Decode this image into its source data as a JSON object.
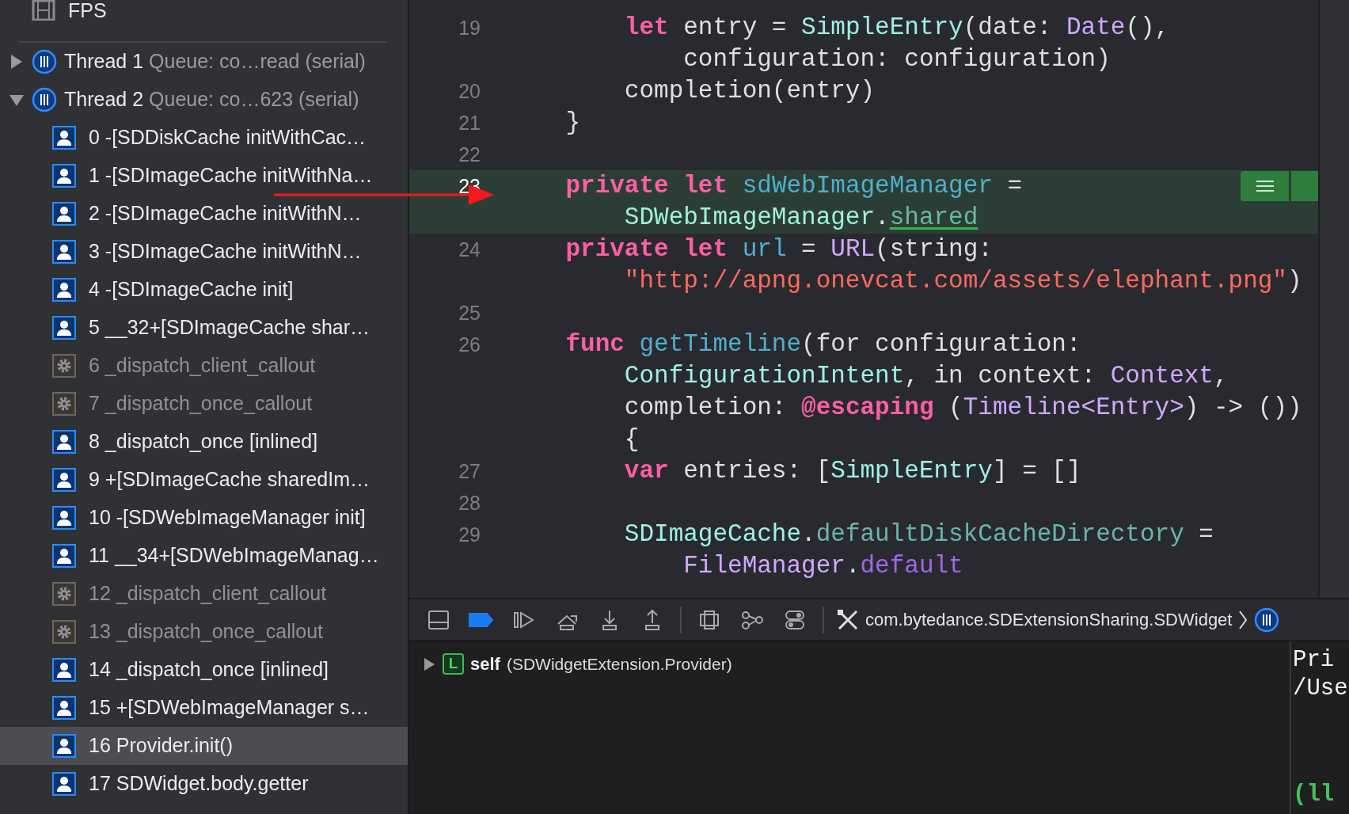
{
  "navigator": {
    "target": "FPS",
    "threads": [
      {
        "name": "Thread 1",
        "queue": "Queue: co…read (serial)",
        "expanded": false
      },
      {
        "name": "Thread 2",
        "queue": "Queue: co…623 (serial)",
        "expanded": true,
        "frames": [
          {
            "label": "0 -[SDDiskCache initWithCac…",
            "kind": "user",
            "selected": false
          },
          {
            "label": "1 -[SDImageCache initWithNa…",
            "kind": "user",
            "selected": false
          },
          {
            "label": "2 -[SDImageCache initWithN…",
            "kind": "user",
            "selected": false
          },
          {
            "label": "3 -[SDImageCache initWithN…",
            "kind": "user",
            "selected": false
          },
          {
            "label": "4 -[SDImageCache init]",
            "kind": "user",
            "selected": false
          },
          {
            "label": "5 __32+[SDImageCache shar…",
            "kind": "user",
            "selected": false
          },
          {
            "label": "6 _dispatch_client_callout",
            "kind": "system",
            "selected": false
          },
          {
            "label": "7 _dispatch_once_callout",
            "kind": "system",
            "selected": false
          },
          {
            "label": "8 _dispatch_once [inlined]",
            "kind": "user",
            "selected": false
          },
          {
            "label": "9 +[SDImageCache sharedIm…",
            "kind": "user",
            "selected": false
          },
          {
            "label": "10 -[SDWebImageManager init]",
            "kind": "user",
            "selected": false
          },
          {
            "label": "11 __34+[SDWebImageManag…",
            "kind": "user",
            "selected": false
          },
          {
            "label": "12 _dispatch_client_callout",
            "kind": "system",
            "selected": false
          },
          {
            "label": "13 _dispatch_once_callout",
            "kind": "system",
            "selected": false
          },
          {
            "label": "14 _dispatch_once [inlined]",
            "kind": "user",
            "selected": false
          },
          {
            "label": "15 +[SDWebImageManager s…",
            "kind": "user",
            "selected": false
          },
          {
            "label": "16 Provider.init()",
            "kind": "user",
            "selected": true
          },
          {
            "label": "17 SDWidget.body.getter",
            "kind": "user",
            "selected": false
          }
        ]
      }
    ]
  },
  "editor": {
    "lines": [
      {
        "number": "19",
        "current": false,
        "rows": [
          {
            "tokens": [
              {
                "text": "        let",
                "kind": "keyword"
              },
              {
                "text": " entry = ",
                "kind": "plain"
              },
              {
                "text": "SimpleEntry",
                "kind": "project_type"
              },
              {
                "text": "(date: ",
                "kind": "plain"
              },
              {
                "text": "Date",
                "kind": "system_type"
              },
              {
                "text": "(),",
                "kind": "plain"
              }
            ]
          },
          {
            "tokens": [
              {
                "text": "            configuration: configuration)",
                "kind": "plain"
              }
            ]
          }
        ]
      },
      {
        "number": "20",
        "current": false,
        "rows": [
          {
            "tokens": [
              {
                "text": "        completion(entry)",
                "kind": "plain"
              }
            ]
          }
        ]
      },
      {
        "number": "21",
        "current": false,
        "rows": [
          {
            "tokens": [
              {
                "text": "    }",
                "kind": "plain"
              }
            ]
          }
        ]
      },
      {
        "number": "22",
        "current": false
      },
      {
        "number": "23",
        "current": true,
        "rows": [
          {
            "tokens": [
              {
                "text": "    private let ",
                "kind": "keyword"
              },
              {
                "text": "sdWebImageManager",
                "kind": "declaration"
              },
              {
                "text": " =",
                "kind": "plain"
              }
            ]
          },
          {
            "tokens": [
              {
                "text": "        SDWebImageManager",
                "kind": "project_type"
              },
              {
                "text": ".",
                "kind": "plain"
              },
              {
                "text": "shared",
                "kind": "project_member",
                "underlined": true
              }
            ]
          }
        ]
      },
      {
        "number": "24",
        "current": false,
        "rows": [
          {
            "tokens": [
              {
                "text": "    private let ",
                "kind": "keyword"
              },
              {
                "text": "url",
                "kind": "declaration"
              },
              {
                "text": " = ",
                "kind": "plain"
              },
              {
                "text": "URL",
                "kind": "system_type"
              },
              {
                "text": "(string:",
                "kind": "plain"
              }
            ]
          },
          {
            "tokens": [
              {
                "text": "        \"http://apng.onevcat.com/assets/elephant.png\"",
                "kind": "string"
              },
              {
                "text": ")",
                "kind": "plain"
              }
            ]
          }
        ]
      },
      {
        "number": "25",
        "current": false
      },
      {
        "number": "26",
        "current": false,
        "rows": [
          {
            "tokens": [
              {
                "text": "    func ",
                "kind": "keyword"
              },
              {
                "text": "getTimeline",
                "kind": "declaration"
              },
              {
                "text": "(for configuration:",
                "kind": "plain"
              }
            ]
          },
          {
            "tokens": [
              {
                "text": "        ConfigurationIntent",
                "kind": "project_type"
              },
              {
                "text": ", in context: ",
                "kind": "plain"
              },
              {
                "text": "Context",
                "kind": "system_type"
              },
              {
                "text": ",",
                "kind": "plain"
              }
            ]
          },
          {
            "tokens": [
              {
                "text": "        completion: ",
                "kind": "plain"
              },
              {
                "text": "@escaping",
                "kind": "keyword"
              },
              {
                "text": " (",
                "kind": "plain"
              },
              {
                "text": "Timeline<Entry>",
                "kind": "system_type"
              },
              {
                "text": ") -> ())",
                "kind": "plain"
              }
            ]
          },
          {
            "tokens": [
              {
                "text": "        {",
                "kind": "plain"
              }
            ]
          }
        ]
      },
      {
        "number": "27",
        "current": false,
        "rows": [
          {
            "tokens": [
              {
                "text": "        var",
                "kind": "keyword"
              },
              {
                "text": " entries: [",
                "kind": "plain"
              },
              {
                "text": "SimpleEntry",
                "kind": "project_type"
              },
              {
                "text": "] = []",
                "kind": "plain"
              }
            ]
          }
        ]
      },
      {
        "number": "28",
        "current": false
      },
      {
        "number": "29",
        "current": false,
        "rows": [
          {
            "tokens": [
              {
                "text": "        SDImageCache",
                "kind": "project_type"
              },
              {
                "text": ".",
                "kind": "plain"
              },
              {
                "text": "defaultDiskCacheDirectory",
                "kind": "project_member"
              },
              {
                "text": " =",
                "kind": "plain"
              }
            ]
          },
          {
            "tokens": [
              {
                "text": "            FileManager",
                "kind": "system_type"
              },
              {
                "text": ".",
                "kind": "plain"
              },
              {
                "text": "default",
                "kind": "system_member"
              }
            ]
          }
        ]
      }
    ]
  },
  "debug_bar": {
    "breakpoints_active": true,
    "path": "com.bytedance.SDExtensionSharing.SDWidget"
  },
  "variables": [
    {
      "badge": "L",
      "name": "self",
      "type": "(SDWidgetExtension.Provider)",
      "expanded": false
    }
  ],
  "console": {
    "lines": [
      {
        "text": "Pri",
        "kind": "output"
      },
      {
        "text": "/Use",
        "kind": "output"
      },
      {
        "text": "(ll",
        "kind": "prompt"
      }
    ]
  }
}
